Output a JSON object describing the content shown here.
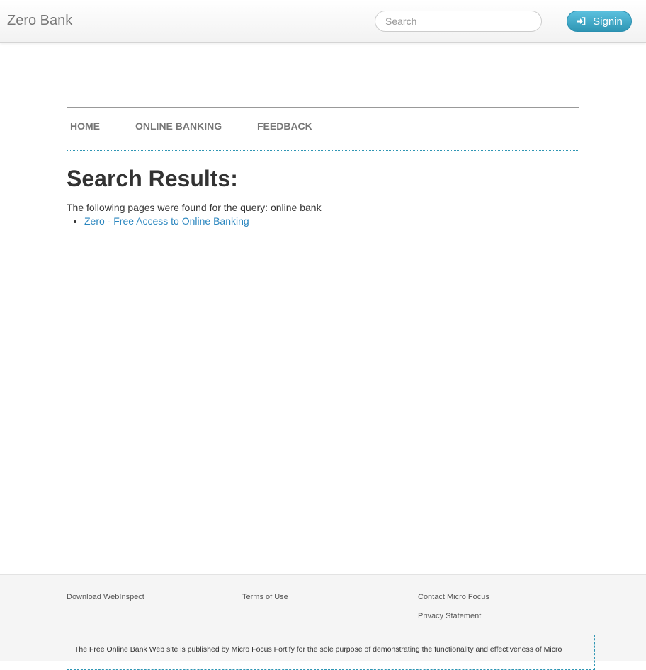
{
  "header": {
    "brand": "Zero Bank",
    "search_placeholder": "Search",
    "signin_label": "Signin"
  },
  "nav": {
    "items": [
      {
        "label": "HOME"
      },
      {
        "label": "ONLINE BANKING"
      },
      {
        "label": "FEEDBACK"
      }
    ]
  },
  "main": {
    "title": "Search Results:",
    "result_text": "The following pages were found for the query: online bank",
    "results": [
      {
        "label": "Zero - Free Access to Online Banking"
      }
    ]
  },
  "footer": {
    "download": "Download WebInspect",
    "terms": "Terms of Use",
    "contact": "Contact Micro Focus",
    "privacy": "Privacy Statement",
    "disclaimer": "The Free Online Bank Web site is published by Micro Focus Fortify for the sole purpose of demonstrating the functionality and effectiveness of Micro"
  },
  "colors": {
    "accent": "#2f96b4",
    "link": "#2a86bf",
    "nav_text": "#777777"
  },
  "icons": {
    "signin": "signin-icon"
  }
}
